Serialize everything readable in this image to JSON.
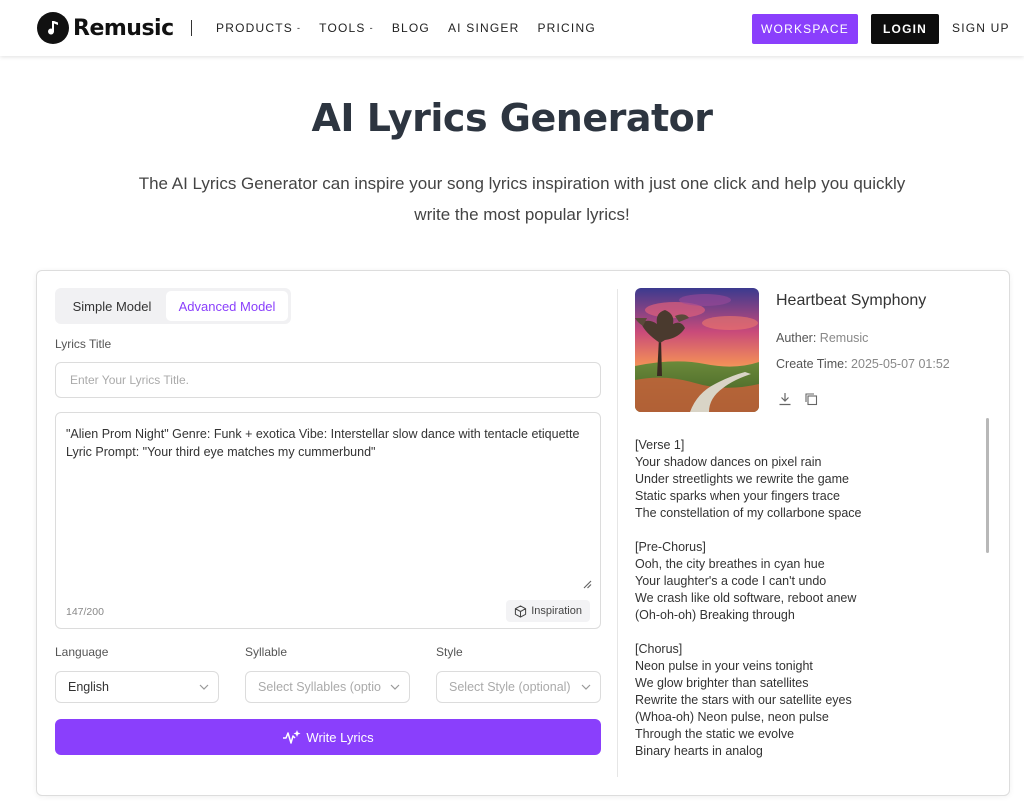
{
  "brand": {
    "name": "Remusic"
  },
  "nav": {
    "items": [
      {
        "label": "PRODUCTS",
        "caret": "-"
      },
      {
        "label": "TOOLS",
        "caret": "-"
      },
      {
        "label": "BLOG"
      },
      {
        "label": "AI SINGER"
      },
      {
        "label": "PRICING"
      }
    ],
    "workspace": "WORKSPACE",
    "login": "LOGIN",
    "signup": "SIGN UP"
  },
  "hero": {
    "title": "AI Lyrics Generator",
    "subtitle": "The AI Lyrics Generator can inspire your song lyrics inspiration with just one click and help you quickly write the most popular lyrics!"
  },
  "form": {
    "tabs": {
      "simple": "Simple Model",
      "advanced": "Advanced Model",
      "active": "advanced"
    },
    "title_label": "Lyrics Title",
    "title_placeholder": "Enter Your Lyrics Title.",
    "prompt_text": "\"Alien Prom Night\" Genre: Funk + exotica Vibe: Interstellar slow dance with tentacle etiquette Lyric Prompt: \"Your third eye matches my cummerbund\"",
    "counter": "147/200",
    "inspiration": "Inspiration",
    "language_label": "Language",
    "language_value": "English",
    "syllable_label": "Syllable",
    "syllable_placeholder": "Select Syllables (optio",
    "style_label": "Style",
    "style_placeholder": "Select Style (optional)",
    "write_button": "Write Lyrics"
  },
  "result": {
    "song_title": "Heartbeat Symphony",
    "author_label": "Auther:",
    "author": "Remusic",
    "time_label": "Create Time:",
    "time": "2025-05-07 01:52",
    "lyrics": [
      "[Verse 1]",
      "Your shadow dances on pixel rain",
      "Under streetlights we rewrite the game",
      "Static sparks when your fingers trace",
      "The constellation of my collarbone space",
      "",
      "[Pre-Chorus]",
      "Ooh, the city breathes in cyan hue",
      "Your laughter's a code I can't undo",
      "We crash like old software, reboot anew",
      "(Oh-oh-oh) Breaking through",
      "",
      "[Chorus]",
      "Neon pulse in your veins tonight",
      "We glow brighter than satellites",
      "Rewrite the stars with our satellite eyes",
      "(Whoa-oh) Neon pulse, neon pulse",
      "Through the static we evolve",
      "Binary hearts in analog"
    ]
  },
  "colors": {
    "accent": "#8a3ffc",
    "login_bg": "#0d0d0d"
  }
}
